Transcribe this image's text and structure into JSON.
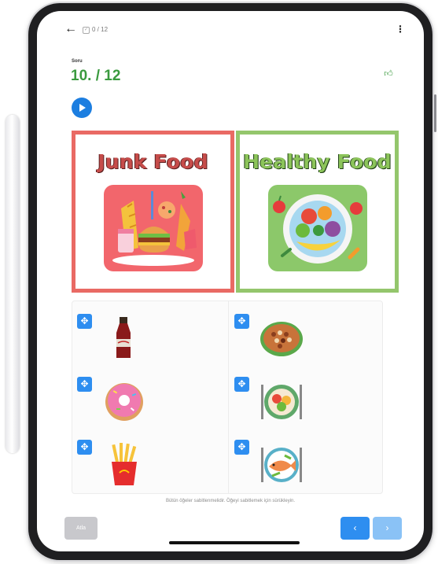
{
  "topbar": {
    "back_icon": "arrow-left-icon",
    "progress_text": "0 / 12",
    "menu_icon": "more-vertical-icon"
  },
  "question": {
    "label": "Soru",
    "number": "10. / 12",
    "like_icon": "thumbs-up-icon",
    "play_icon": "play-icon"
  },
  "categories": [
    {
      "title": "Junk Food",
      "color": "#e96a64"
    },
    {
      "title": "Healthy Food",
      "color": "#94c66c"
    }
  ],
  "items": [
    {
      "name": "cola-bottle"
    },
    {
      "name": "donut"
    },
    {
      "name": "french-fries"
    },
    {
      "name": "bowl-of-beans"
    },
    {
      "name": "plate-of-food"
    },
    {
      "name": "fish-plate"
    }
  ],
  "hint": "Bütün öğeler sabitlenmelidir. Öğeyi sabitlemek için sürükleyin.",
  "footer": {
    "skip_label": "Atla",
    "prev_label": "‹",
    "next_label": "›"
  },
  "colors": {
    "accent": "#2e8ef0",
    "question_green": "#3a9a3e",
    "junk_red": "#e96a64",
    "healthy_green": "#94c66c"
  }
}
